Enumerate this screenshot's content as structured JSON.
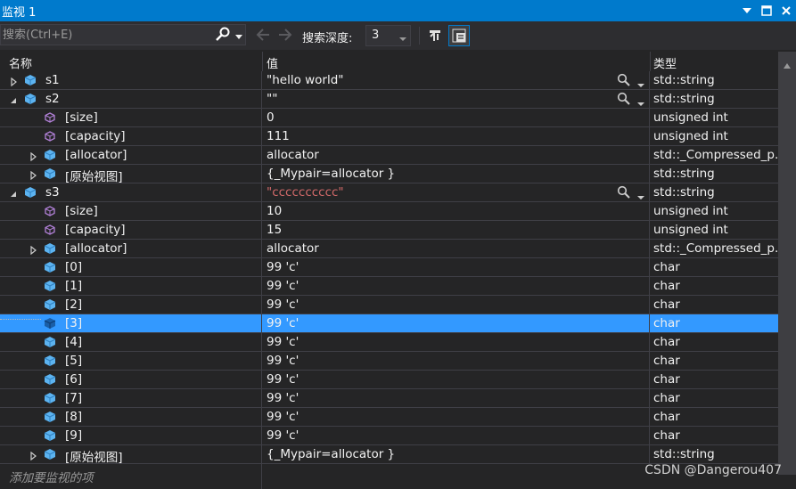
{
  "window": {
    "title": "监视 1"
  },
  "toolbar": {
    "search_placeholder": "搜索(Ctrl+E)",
    "depth_label": "搜索深度:",
    "depth_value": "3"
  },
  "columns": {
    "name": "名称",
    "value": "值",
    "type": "类型"
  },
  "rows": [
    {
      "name": "s1",
      "value": "\"hello world\"",
      "type": "std::string"
    },
    {
      "name": "s2",
      "value": "\"\"",
      "type": "std::string"
    },
    {
      "name": "[size]",
      "value": "0",
      "type": "unsigned int"
    },
    {
      "name": "[capacity]",
      "value": "111",
      "type": "unsigned int"
    },
    {
      "name": "[allocator]",
      "value": "allocator",
      "type": "std::_Compressed_p..."
    },
    {
      "name": "[原始视图]",
      "value": "{_Mypair=allocator }",
      "type": "std::string"
    },
    {
      "name": "s3",
      "value": "\"cccccccccc\"",
      "type": "std::string"
    },
    {
      "name": "[size]",
      "value": "10",
      "type": "unsigned int"
    },
    {
      "name": "[capacity]",
      "value": "15",
      "type": "unsigned int"
    },
    {
      "name": "[allocator]",
      "value": "allocator",
      "type": "std::_Compressed_p..."
    },
    {
      "name": "[0]",
      "value": "99 'c'",
      "type": "char"
    },
    {
      "name": "[1]",
      "value": "99 'c'",
      "type": "char"
    },
    {
      "name": "[2]",
      "value": "99 'c'",
      "type": "char"
    },
    {
      "name": "[3]",
      "value": "99 'c'",
      "type": "char"
    },
    {
      "name": "[4]",
      "value": "99 'c'",
      "type": "char"
    },
    {
      "name": "[5]",
      "value": "99 'c'",
      "type": "char"
    },
    {
      "name": "[6]",
      "value": "99 'c'",
      "type": "char"
    },
    {
      "name": "[7]",
      "value": "99 'c'",
      "type": "char"
    },
    {
      "name": "[8]",
      "value": "99 'c'",
      "type": "char"
    },
    {
      "name": "[9]",
      "value": "99 'c'",
      "type": "char"
    },
    {
      "name": "[原始视图]",
      "value": "{_Mypair=allocator }",
      "type": "std::string"
    }
  ],
  "add_item_placeholder": "添加要监视的项",
  "watermark": "CSDN @Dangerou407",
  "colors": {
    "accent": "#007acc",
    "selection": "#3399ff",
    "changed_value": "#d16969",
    "object_icon": "#5cb3f0",
    "member_icon": "#b180d7"
  },
  "icons": {
    "object": "cube-icon",
    "member": "property-icon"
  }
}
